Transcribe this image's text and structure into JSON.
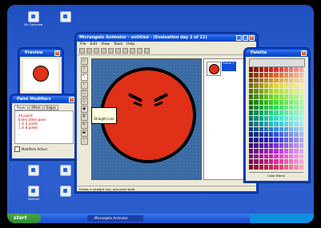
{
  "desktop": {
    "icons": [
      {
        "label": "My Computer"
      },
      {
        "label": ""
      },
      {
        "label": ""
      },
      {
        "label": ""
      },
      {
        "label": "Internet"
      },
      {
        "label": ""
      },
      {
        "label": ""
      },
      {
        "label": ""
      }
    ]
  },
  "main_window": {
    "title": "Micrangelo Animator - untitled - (Evaluation day 2 of 21)",
    "menu": [
      "File",
      "Edit",
      "View",
      "Tools",
      "Help"
    ],
    "tooltip": "Straight Line",
    "status": "Draws a straight line, one pixel wide.",
    "frame_label": "Frame 1"
  },
  "preview_window": {
    "title": "Preview"
  },
  "paint_modifiers": {
    "title": "Paint Modifiers",
    "tabs": [
      "Pixels",
      "Effect",
      "Edges"
    ],
    "options": [
      "All pixels",
      "Every other pixel",
      "1 in 4 pixels",
      "1 in 8 pixels"
    ],
    "checkbox_label": "Modifiers Active"
  },
  "palette_window": {
    "title": "Palette",
    "blend_label": "Color Blend"
  },
  "taskbar": {
    "start_label": "start",
    "task_label": "Micrangelo Animator"
  },
  "colors": {
    "face_red": "#e03018",
    "outline": "#000000",
    "canvas_bg": "#3f6fa8",
    "xp_blue": "#0d4fd8"
  }
}
